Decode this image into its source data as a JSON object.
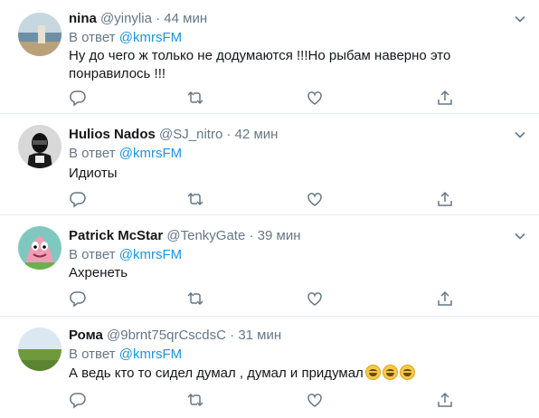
{
  "tweets": [
    {
      "name": "nina",
      "handle": "@yinylia",
      "dot": "·",
      "time": "44 мин",
      "reply_prefix": "В ответ",
      "reply_to": "@kmrsFM",
      "text_line1": "Ну до чего ж только не додумаются !!!Но рыбам наверно это",
      "text_line2": "понравилось !!!"
    },
    {
      "name": "Hulios Nados",
      "handle": "@SJ_nitro",
      "dot": "·",
      "time": "42 мин",
      "reply_prefix": "В ответ",
      "reply_to": "@kmrsFM",
      "text_line1": "Идиоты"
    },
    {
      "name": "Patrick McStar",
      "handle": "@TenkyGate",
      "dot": "·",
      "time": "39 мин",
      "reply_prefix": "В ответ",
      "reply_to": "@kmrsFM",
      "text_line1": "Ахренеть"
    },
    {
      "name": "Рома",
      "handle": "@9brnt75qrCscdsC",
      "dot": "·",
      "time": "31 мин",
      "reply_prefix": "В ответ",
      "reply_to": "@kmrsFM",
      "text_line1": "А ведь кто то сидел думал , думал и придумал",
      "emoji": [
        "grinning-face",
        "grinning-face",
        "grinning-face"
      ]
    }
  ],
  "colors": {
    "text": "#14171a",
    "muted": "#657786",
    "link": "#1b95e0",
    "divider": "#e6ecf0",
    "icon": "#657786"
  }
}
